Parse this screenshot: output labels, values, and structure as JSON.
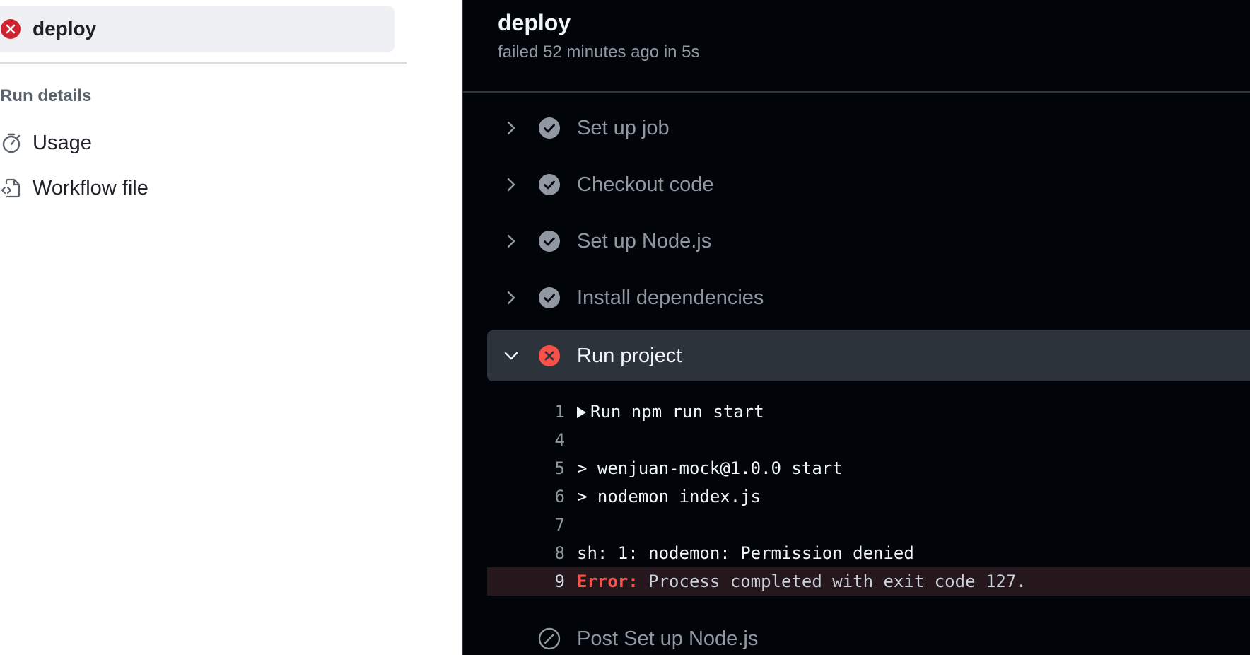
{
  "sidebar": {
    "job": {
      "label": "deploy",
      "status": "failed"
    },
    "section_heading": "Run details",
    "links": [
      {
        "label": "Usage",
        "icon": "stopwatch-icon"
      },
      {
        "label": "Workflow file",
        "icon": "file-code-icon"
      }
    ]
  },
  "panel": {
    "title": "deploy",
    "subtitle": "failed 52 minutes ago in 5s",
    "steps": [
      {
        "label": "Set up job",
        "status": "success"
      },
      {
        "label": "Checkout code",
        "status": "success"
      },
      {
        "label": "Set up Node.js",
        "status": "success"
      },
      {
        "label": "Install dependencies",
        "status": "success"
      },
      {
        "label": "Run project",
        "status": "failure",
        "expanded": true
      },
      {
        "label": "Post Set up Node.js",
        "status": "skipped"
      }
    ],
    "log": {
      "lines": [
        {
          "number": "1",
          "text": "Run npm run start"
        },
        {
          "number": "4",
          "text": ""
        },
        {
          "number": "5",
          "text": "> wenjuan-mock@1.0.0 start"
        },
        {
          "number": "6",
          "text": "> nodemon index.js"
        },
        {
          "number": "7",
          "text": ""
        },
        {
          "number": "8",
          "text": "sh: 1: nodemon: Permission denied"
        },
        {
          "number": "9",
          "prefix": "Error:",
          "text": " Process completed with exit code 127."
        }
      ]
    }
  },
  "colors": {
    "failure": "#f85149",
    "success": "#9198a1",
    "panel_bg": "#010409",
    "selected_bg": "#2d333b"
  }
}
